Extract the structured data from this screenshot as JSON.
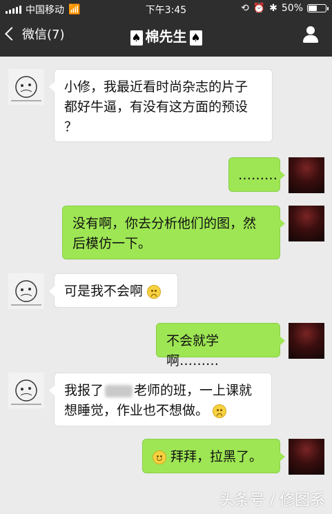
{
  "status": {
    "carrier": "中国移动",
    "time": "下午3:45",
    "battery": "50%",
    "battery_level": 0.5
  },
  "nav": {
    "back_label": "微信(7)",
    "title": "棉先生",
    "spade_glyph": "♠"
  },
  "messages": [
    {
      "side": "in",
      "text_lines": [
        "小修，我最近看时尚杂志的片子",
        "都好牛逼，有没有这方面的预设",
        "？"
      ]
    },
    {
      "side": "out",
      "text": "………"
    },
    {
      "side": "out",
      "text_lines": [
        "没有啊，你去分析他们的图，然",
        "后模仿一下。"
      ]
    },
    {
      "side": "in",
      "text": "可是我不会啊",
      "emoji": "sad"
    },
    {
      "side": "out",
      "text": "不会就学啊………"
    },
    {
      "side": "in",
      "text_lines": [
        "我报了",
        "老师的班，一上课就",
        "想睡觉，作业也不想做。"
      ],
      "emoji": "sad"
    },
    {
      "side": "out",
      "text": "拜拜，拉黑了。",
      "emoji": "happy"
    }
  ],
  "watermark": "头条号 / 修图系"
}
